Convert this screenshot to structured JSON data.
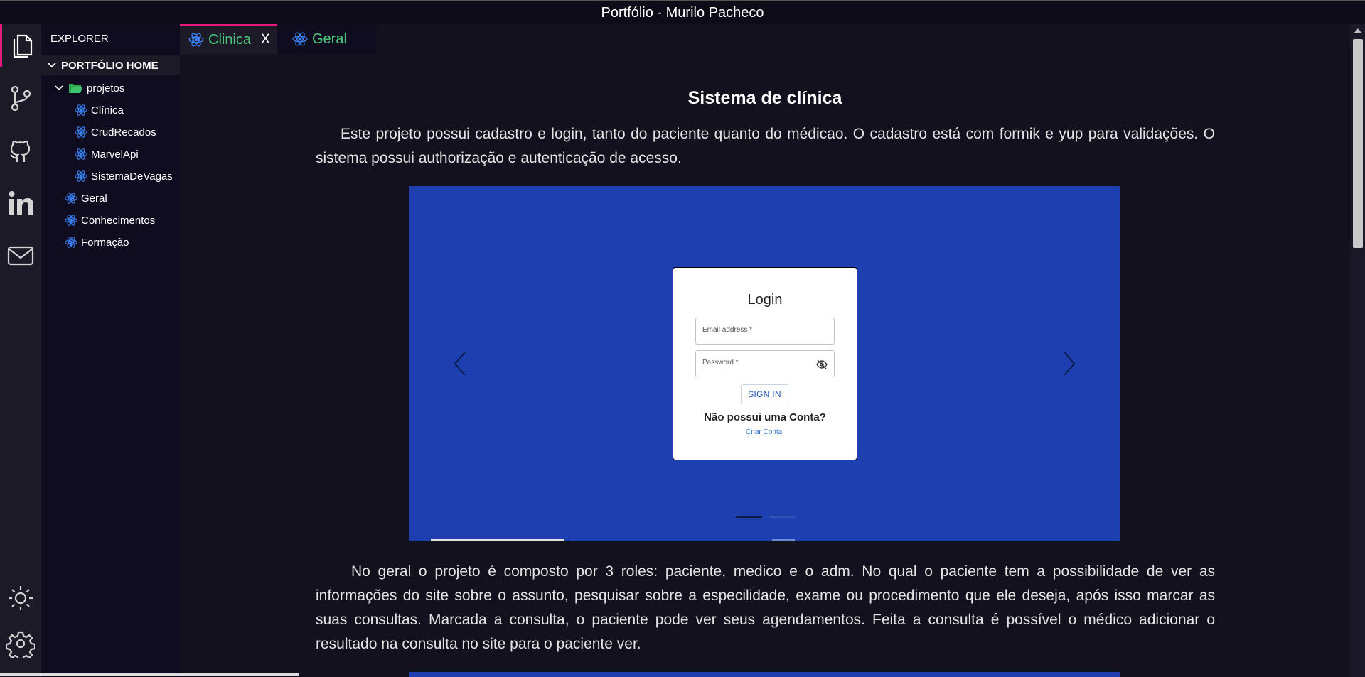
{
  "window": {
    "title": "Portfólio - Murilo Pacheco"
  },
  "activity_bar": {
    "items": [
      {
        "icon": "files-icon"
      },
      {
        "icon": "source-control-icon"
      },
      {
        "icon": "github-icon"
      },
      {
        "icon": "linkedin-icon"
      },
      {
        "icon": "mail-icon"
      },
      {
        "icon": "theme-sun-icon"
      },
      {
        "icon": "settings-gear-icon"
      }
    ]
  },
  "sidebar": {
    "header": "EXPLORER",
    "root": "PORTFÓLIO HOME",
    "folder": "projetos",
    "project_items": [
      "Clínica",
      "CrudRecados",
      "MarvelApi",
      "SistemaDeVagas"
    ],
    "top_items": [
      "Geral",
      "Conhecimentos",
      "Formação"
    ]
  },
  "tabs": [
    {
      "label": "Clinica",
      "close": "X"
    },
    {
      "label": "Geral"
    }
  ],
  "content": {
    "title": "Sistema de clínica",
    "paragraph1": "Este projeto possui cadastro e login, tanto do paciente quanto do médicao. O cadastro está com formik e yup para validações. O sistema possui authorização e autenticação de acesso.",
    "paragraph2": "No geral o projeto é composto por 3 roles: paciente, medico e o adm. No qual o paciente tem a possibilidade de ver as informações do site sobre o assunto, pesquisar sobre a especilidade, exame ou procedimento que ele deseja, após isso marcar as suas consultas. Marcada a consulta, o paciente pode ver seus agendamentos. Feita a consulta é possível o médico adicionar o resultado na consulta no site para o paciente ver."
  },
  "login_preview": {
    "title": "Login",
    "email_label": "Email address *",
    "password_label": "Password *",
    "signin": "SIGN IN",
    "no_account": "Não possui uma Conta?",
    "create_account": "Criar Conta."
  },
  "colors": {
    "accent": "#e5197e",
    "tab_text": "#4ec97c",
    "carousel_bg": "#1d3fb0",
    "react_icon": "#3b82f6"
  }
}
